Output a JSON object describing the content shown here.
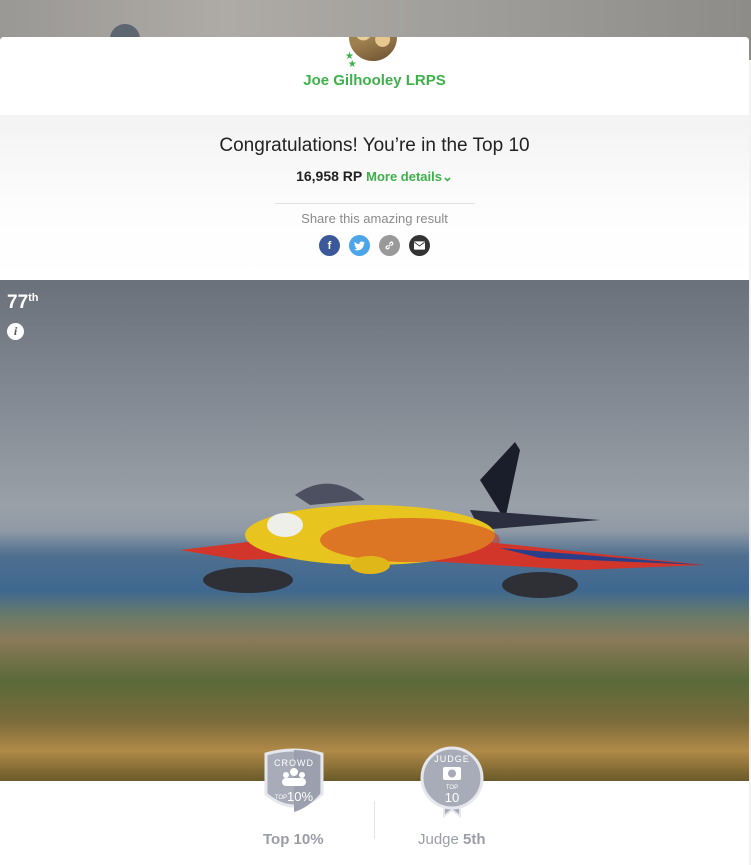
{
  "profile": {
    "user_name": "Joe Gilhooley LRPS",
    "avatar_icon": "owls-photo-avatar",
    "crown_icon": "crown-icon",
    "stars_icon": "stars-icon"
  },
  "result": {
    "headline": "Congratulations! You’re in the Top 10",
    "points": "16,958 RP",
    "more_details": "More details",
    "more_details_chevron": "⌄",
    "share_label": "Share this amazing result",
    "share_buttons": [
      {
        "name": "facebook",
        "glyph": "f",
        "color": "#3b5998"
      },
      {
        "name": "twitter",
        "glyph": "t",
        "color": "#4ba5e8"
      },
      {
        "name": "copy-link",
        "glyph": "🔗",
        "color": "#999999"
      },
      {
        "name": "email",
        "glyph": "✉",
        "color": "#333333"
      }
    ]
  },
  "photo": {
    "rank_number": "77",
    "rank_suffix": "th",
    "info_glyph": "i"
  },
  "awards": {
    "crowd_badge": {
      "title": "CROWD",
      "small": "TOP",
      "value": "10%"
    },
    "judge_badge": {
      "title": "JUDGE",
      "small": "TOP",
      "value": "10"
    },
    "crowd_label": "Top 10%",
    "judge_label_prefix": "Judge",
    "judge_label_rank": "5th"
  },
  "colors": {
    "accent_green": "#3db14a",
    "award_grey": "#9a9ca8"
  }
}
